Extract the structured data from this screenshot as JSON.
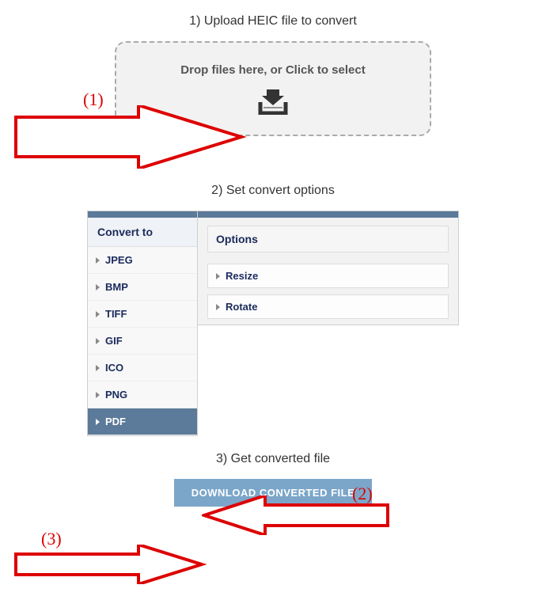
{
  "step1_title": "1) Upload HEIC file to convert",
  "dropzone_text": "Drop files here, or Click to select",
  "step2_title": "2) Set convert options",
  "convert_to_label": "Convert to",
  "formats": {
    "jpeg": "JPEG",
    "bmp": "BMP",
    "tiff": "TIFF",
    "gif": "GIF",
    "ico": "ICO",
    "png": "PNG",
    "pdf": "PDF"
  },
  "options_label": "Options",
  "option_resize": "Resize",
  "option_rotate": "Rotate",
  "step3_title": "3) Get converted file",
  "download_btn": "DOWNLOAD CONVERTED FILE",
  "annotations": {
    "a1": "(1)",
    "a2": "(2)",
    "a3": "(3)"
  }
}
